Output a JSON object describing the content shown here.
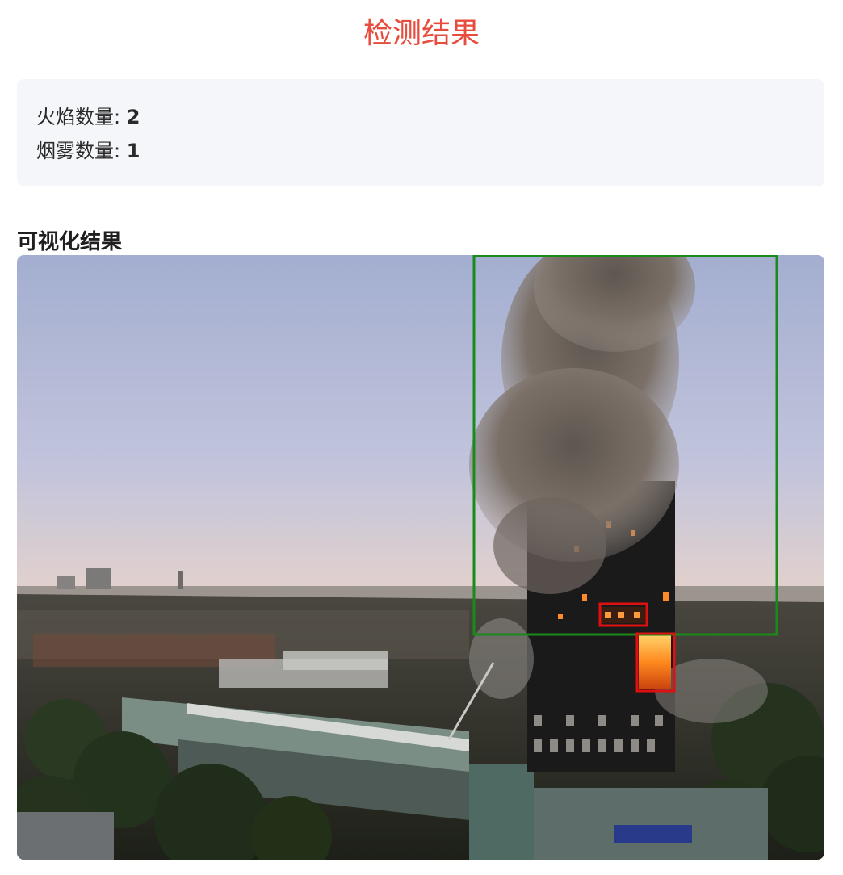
{
  "header": {
    "title": "检测结果"
  },
  "summary": {
    "fire": {
      "label": "火焰数量: ",
      "value": "2"
    },
    "smoke": {
      "label": "烟雾数量: ",
      "value": "1"
    }
  },
  "visualization": {
    "title": "可视化结果",
    "detections": [
      {
        "class": "smoke",
        "color": "#1a8a1a"
      },
      {
        "class": "fire",
        "color": "#e01010"
      },
      {
        "class": "fire",
        "color": "#e01010"
      }
    ]
  }
}
